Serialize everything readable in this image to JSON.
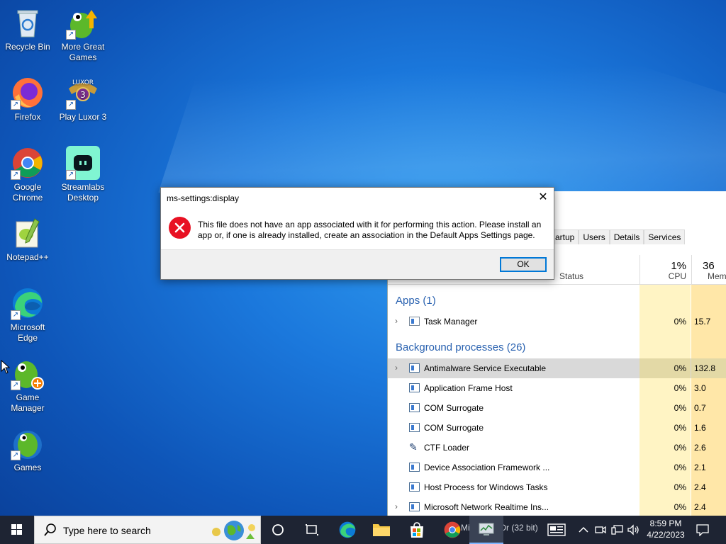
{
  "desktop": {
    "icons": [
      {
        "label": "Recycle Bin"
      },
      {
        "label": "More Great Games"
      },
      {
        "label": "Firefox"
      },
      {
        "label": "Play Luxor 3"
      },
      {
        "label": "Google Chrome"
      },
      {
        "label": "Streamlabs Desktop"
      },
      {
        "label": "Notepad++"
      },
      {
        "label": "Microsoft Edge"
      },
      {
        "label": "Game Manager"
      },
      {
        "label": "Games"
      }
    ]
  },
  "dialog": {
    "title": "ms-settings:display",
    "close": "✕",
    "message": "This file does not have an app associated with it for performing this action. Please install an app or, if one is already installed, create an association in the Default Apps Settings page.",
    "ok_label": "OK"
  },
  "task_manager": {
    "tabs": [
      "artup",
      "Users",
      "Details",
      "Services"
    ],
    "columns": {
      "status": "Status",
      "cpu_pct": "1%",
      "cpu": "CPU",
      "mem_pct": "36",
      "mem": "Mem"
    },
    "apps_group": "Apps (1)",
    "bg_group": "Background processes (26)",
    "apps": [
      {
        "name": "Task Manager",
        "cpu": "0%",
        "mem": "15.7"
      }
    ],
    "processes": [
      {
        "name": "Antimalware Service Executable",
        "cpu": "0%",
        "mem": "132.8"
      },
      {
        "name": "Application Frame Host",
        "cpu": "0%",
        "mem": "3.0"
      },
      {
        "name": "COM Surrogate",
        "cpu": "0%",
        "mem": "0.7"
      },
      {
        "name": "COM Surrogate",
        "cpu": "0%",
        "mem": "1.6"
      },
      {
        "name": "CTF Loader",
        "cpu": "0%",
        "mem": "2.6"
      },
      {
        "name": "Device Association Framework ...",
        "cpu": "0%",
        "mem": "2.1"
      },
      {
        "name": "Host Process for Windows Tasks",
        "cpu": "0%",
        "mem": "2.4"
      },
      {
        "name": "Microsoft Network Realtime Ins...",
        "cpu": "0%",
        "mem": "2.4"
      }
    ]
  },
  "taskbar": {
    "search_placeholder": "Type here to search",
    "pinned_hint": "Micro    OneDr  (32 bit)",
    "time": "8:59 PM",
    "date": "4/22/2023"
  },
  "colors": {
    "accent": "#0078d7",
    "error": "#e81123",
    "taskbar": "#1e2433",
    "group_text": "#2a62b0"
  }
}
